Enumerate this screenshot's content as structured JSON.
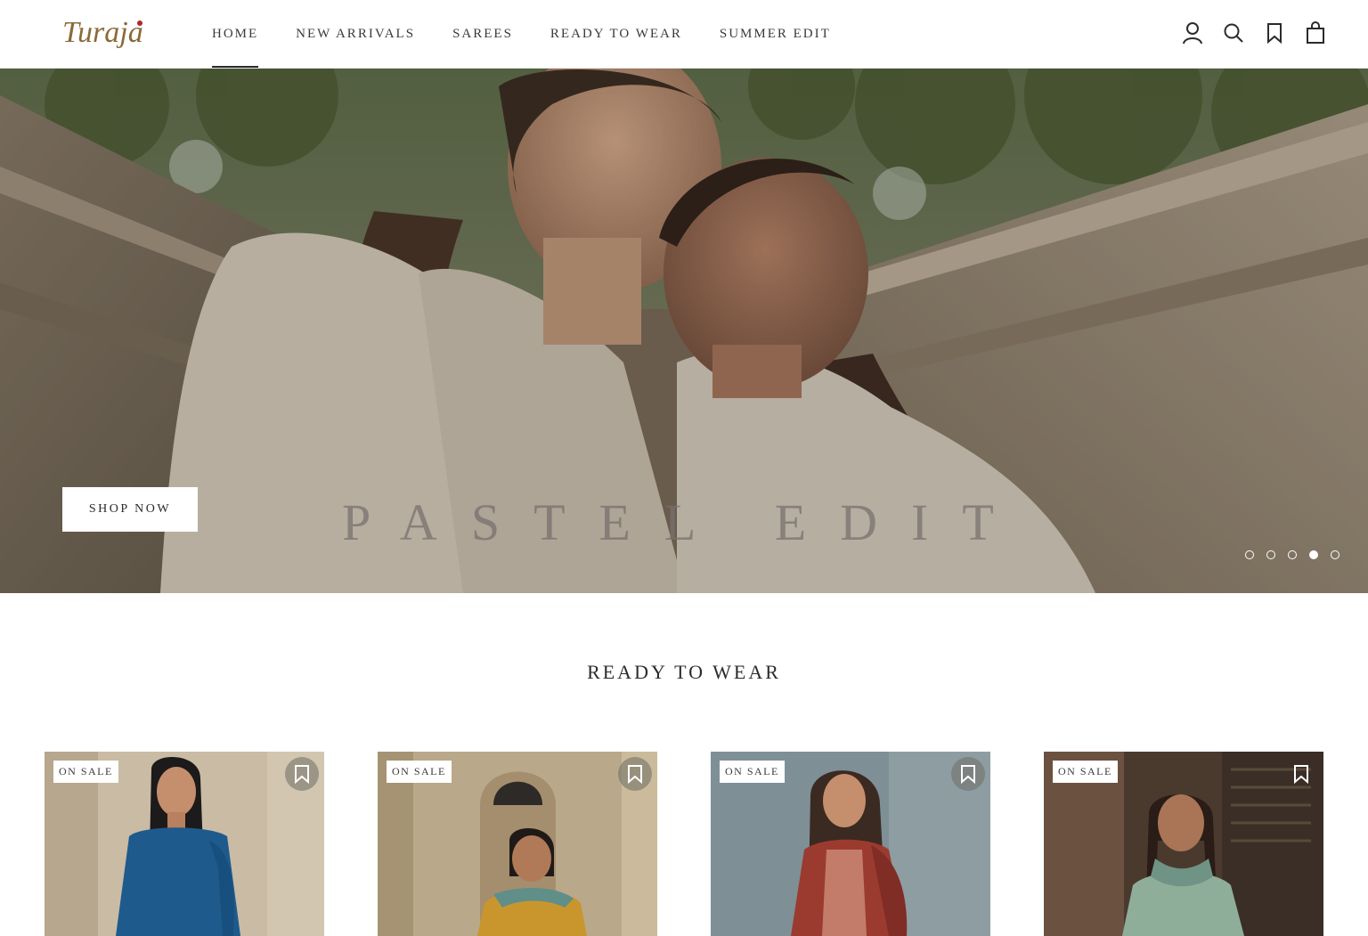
{
  "brand": {
    "logo_text": "Turaja",
    "logo_color": "#8a6a3a",
    "logo_accent_color": "#b3262b"
  },
  "nav": {
    "items": [
      {
        "label": "HOME",
        "active": true
      },
      {
        "label": "NEW ARRIVALS",
        "active": false
      },
      {
        "label": "SAREES",
        "active": false
      },
      {
        "label": "READY TO WEAR",
        "active": false
      },
      {
        "label": "SUMMER EDIT",
        "active": false
      }
    ]
  },
  "header_icons": [
    "account-icon",
    "search-icon",
    "wishlist-icon",
    "cart-icon"
  ],
  "hero": {
    "title": "PASTEL EDIT",
    "cta_label": "SHOP NOW",
    "slide_count": 5,
    "active_slide": 4
  },
  "section": {
    "title": "READY TO WEAR"
  },
  "products": [
    {
      "badge": "ON SALE",
      "bg": "#c9bba4",
      "outfit": "#1e5a8c"
    },
    {
      "badge": "ON SALE",
      "bg": "#b9a98a",
      "outfit": "#c9962e"
    },
    {
      "badge": "ON SALE",
      "bg": "#7f8f96",
      "outfit": "#9b3b2f"
    },
    {
      "badge": "ON SALE",
      "bg": "#4a3a2e",
      "outfit": "#8fae9a"
    }
  ],
  "colors": {
    "text": "#2b2b2b",
    "header_bg": "#ffffff",
    "badge_bg": "#ffffff"
  }
}
